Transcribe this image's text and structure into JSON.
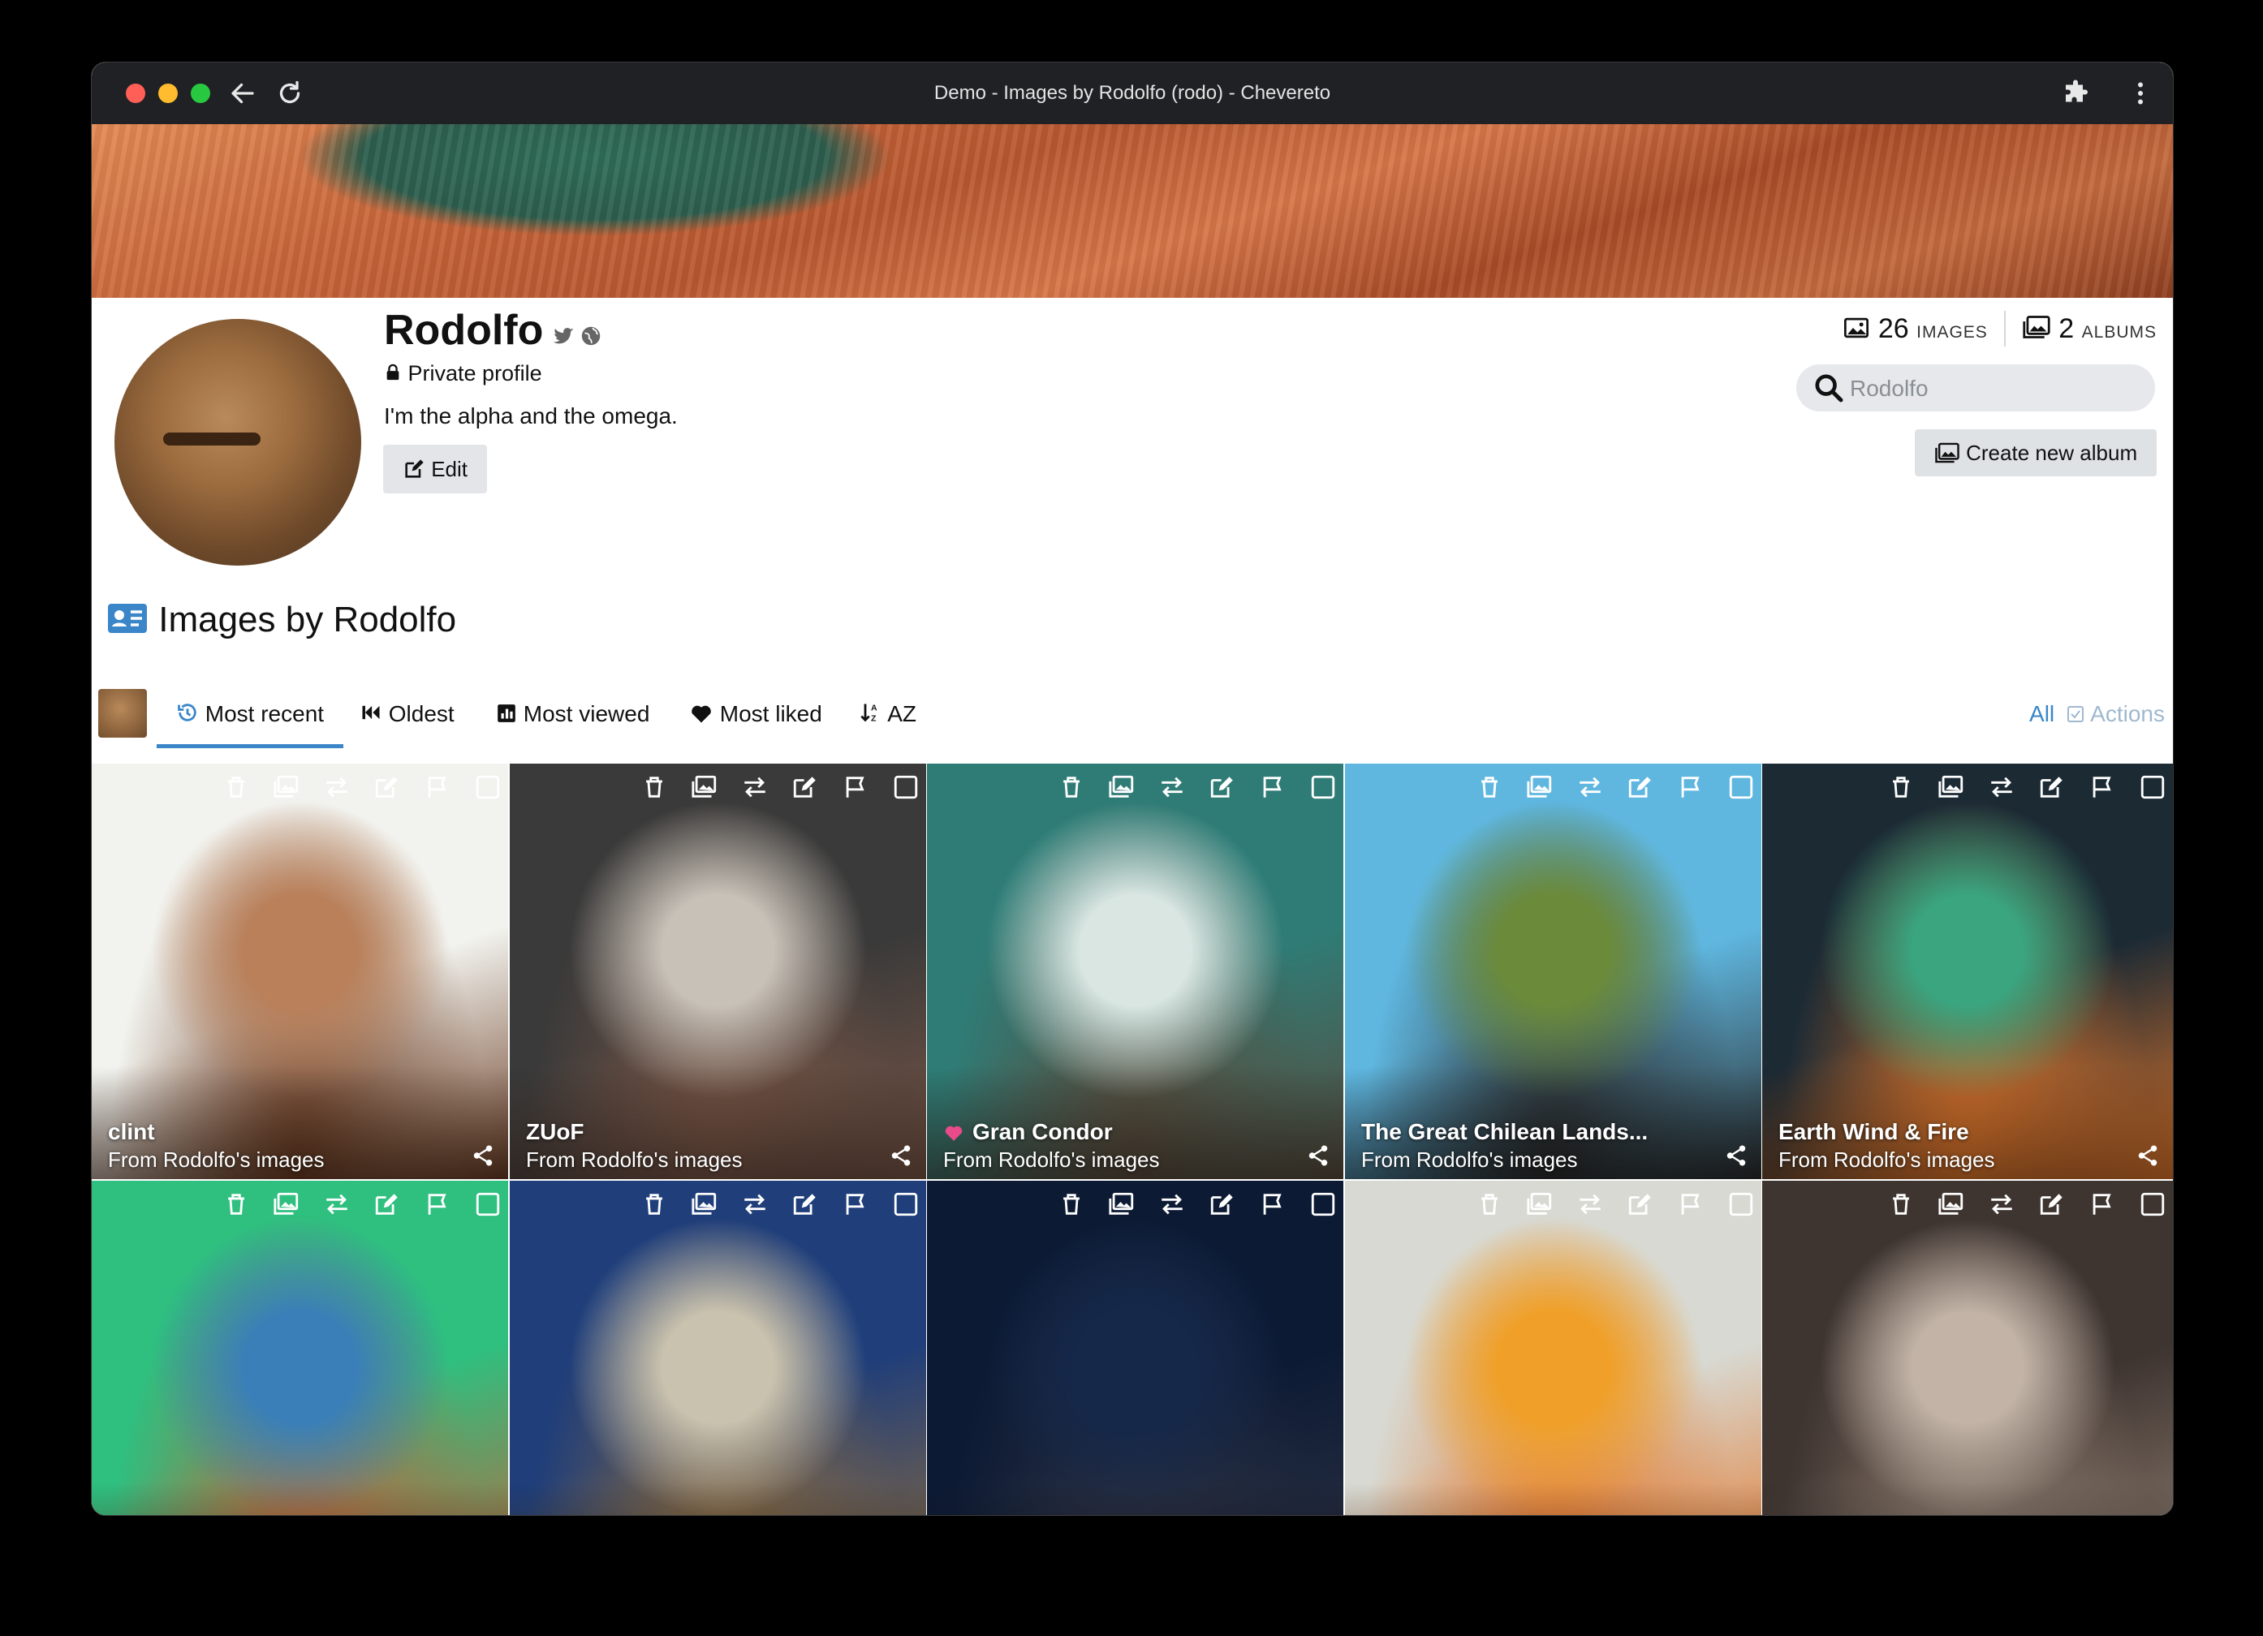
{
  "window": {
    "title": "Demo - Images by Rodolfo (rodo) - Chevereto"
  },
  "profile": {
    "name": "Rodolfo",
    "privacy": "Private profile",
    "bio": "I'm the alpha and the omega.",
    "edit_label": "Edit",
    "images_count": "26",
    "images_label": "IMAGES",
    "albums_count": "2",
    "albums_label": "ALBUMS",
    "search_placeholder": "Rodolfo",
    "create_album_label": "Create new album"
  },
  "section": {
    "title": "Images by Rodolfo"
  },
  "tabs": [
    {
      "label": "Most recent",
      "icon": "history-icon",
      "active": true
    },
    {
      "label": "Oldest",
      "icon": "backward-icon",
      "active": false
    },
    {
      "label": "Most viewed",
      "icon": "chart-icon",
      "active": false
    },
    {
      "label": "Most liked",
      "icon": "heart-icon",
      "active": false
    },
    {
      "label": "AZ",
      "icon": "sort-alpha-icon",
      "active": false
    }
  ],
  "list_controls": {
    "all_label": "All",
    "actions_label": "Actions"
  },
  "tiles": [
    {
      "title": "clint",
      "subtitle": "From Rodolfo's images",
      "colors": [
        "#f2f3ef",
        "#b9805a",
        "#6b3c22"
      ]
    },
    {
      "title": "ZUoF",
      "subtitle": "From Rodolfo's images",
      "colors": [
        "#3a3a3a",
        "#c7c1b8",
        "#7a5646"
      ]
    },
    {
      "title": "Gran Condor",
      "subtitle": "From Rodolfo's images",
      "colors": [
        "#2f7c76",
        "#d9e6e2",
        "#5a4b3c"
      ],
      "liked": true
    },
    {
      "title": "The Great Chilean Lands...",
      "subtitle": "From Rodolfo's images",
      "colors": [
        "#5fb7e0",
        "#6b8a3a",
        "#2a2a2a"
      ]
    },
    {
      "title": "Earth Wind & Fire",
      "subtitle": "From Rodolfo's images",
      "colors": [
        "#1c2a34",
        "#3aa57f",
        "#e0762b"
      ]
    },
    {
      "title": "",
      "subtitle": "",
      "colors": [
        "#2fbf7f",
        "#3a7fb8",
        "#c0643c"
      ]
    },
    {
      "title": "",
      "subtitle": "",
      "colors": [
        "#1f3e7a",
        "#c9c2ae",
        "#8b6a3d"
      ]
    },
    {
      "title": "",
      "subtitle": "",
      "colors": [
        "#0c1a34",
        "#15284a",
        "#2c3142"
      ]
    },
    {
      "title": "",
      "subtitle": "",
      "colors": [
        "#d8d9d2",
        "#f0a028",
        "#e2762a"
      ]
    },
    {
      "title": "",
      "subtitle": "",
      "colors": [
        "#3e3430",
        "#c2b3a6",
        "#8e7d70"
      ]
    }
  ]
}
